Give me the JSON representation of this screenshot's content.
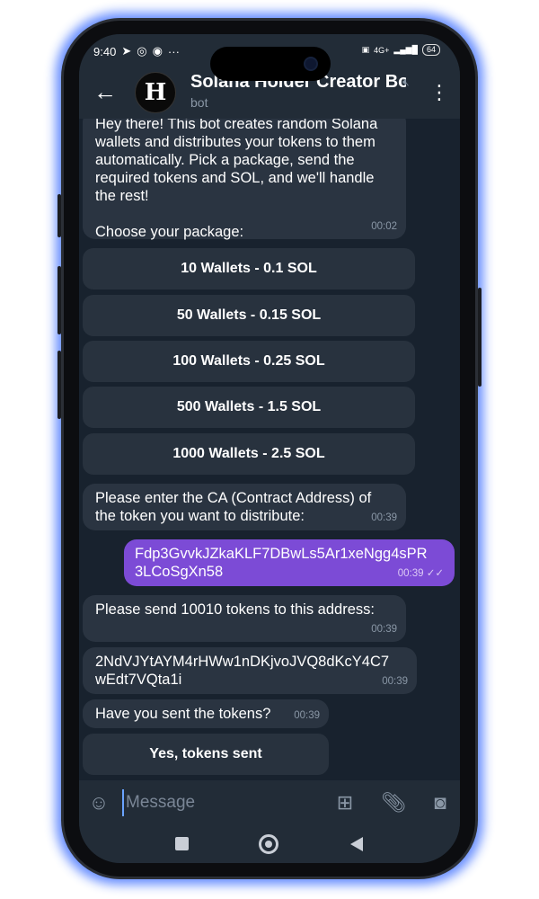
{
  "status_bar": {
    "time": "9:40",
    "left_icons": [
      "send-icon",
      "whatsapp-icon",
      "messenger-icon",
      "more-dots-icon"
    ],
    "network": "4G+",
    "battery": "64"
  },
  "header": {
    "back_icon": "arrow-left-icon",
    "avatar_letter": "H",
    "title": "Solana Holder Creator Bot",
    "subtitle": "bot",
    "menu_icon": "vertical-dots-icon"
  },
  "messages": [
    {
      "direction": "in",
      "text": "Hey there! This bot creates random Solana\nwallets and distributes your tokens to them\nautomatically. Pick a package, send the\nrequired tokens and SOL, and we'll handle\nthe rest!\n\nChoose your package:",
      "time": "00:02"
    },
    {
      "direction": "in",
      "text": "Please enter the CA (Contract Address) of\nthe token you want to distribute:",
      "time": "00:39"
    },
    {
      "direction": "out",
      "text": "Fdp3GvvkJZkaKLF7DBwLs5Ar1xeNgg4sPR\n3LCoSgXn58",
      "time": "00:39",
      "status": "read"
    },
    {
      "direction": "in",
      "text": "Please send 10010 tokens to this address:",
      "time": "00:39"
    },
    {
      "direction": "in",
      "text": "2NdVJYtAYM4rHWw1nDKjvoJVQ8dKcY4C7\nwEdt7VQta1i",
      "time": "00:39"
    },
    {
      "direction": "in",
      "text": "Have you sent the tokens?",
      "time": "00:39"
    }
  ],
  "package_buttons": [
    "10 Wallets - 0.1 SOL",
    "50 Wallets - 0.15 SOL",
    "100 Wallets - 0.25 SOL",
    "500 Wallets - 1.5 SOL",
    "1000 Wallets - 2.5 SOL"
  ],
  "confirm_button": "Yes, tokens sent",
  "input": {
    "placeholder": "Message",
    "emoji_icon": "smile-icon",
    "bot_commands_icon": "grid-icon",
    "attach_icon": "paperclip-icon",
    "camera_icon": "camera-icon"
  },
  "colors": {
    "outgoing_bubble": "#7c4bd6",
    "incoming_bubble": "#2a3441",
    "chat_background": "#18222e",
    "phone_glow": "#5d86ff"
  }
}
